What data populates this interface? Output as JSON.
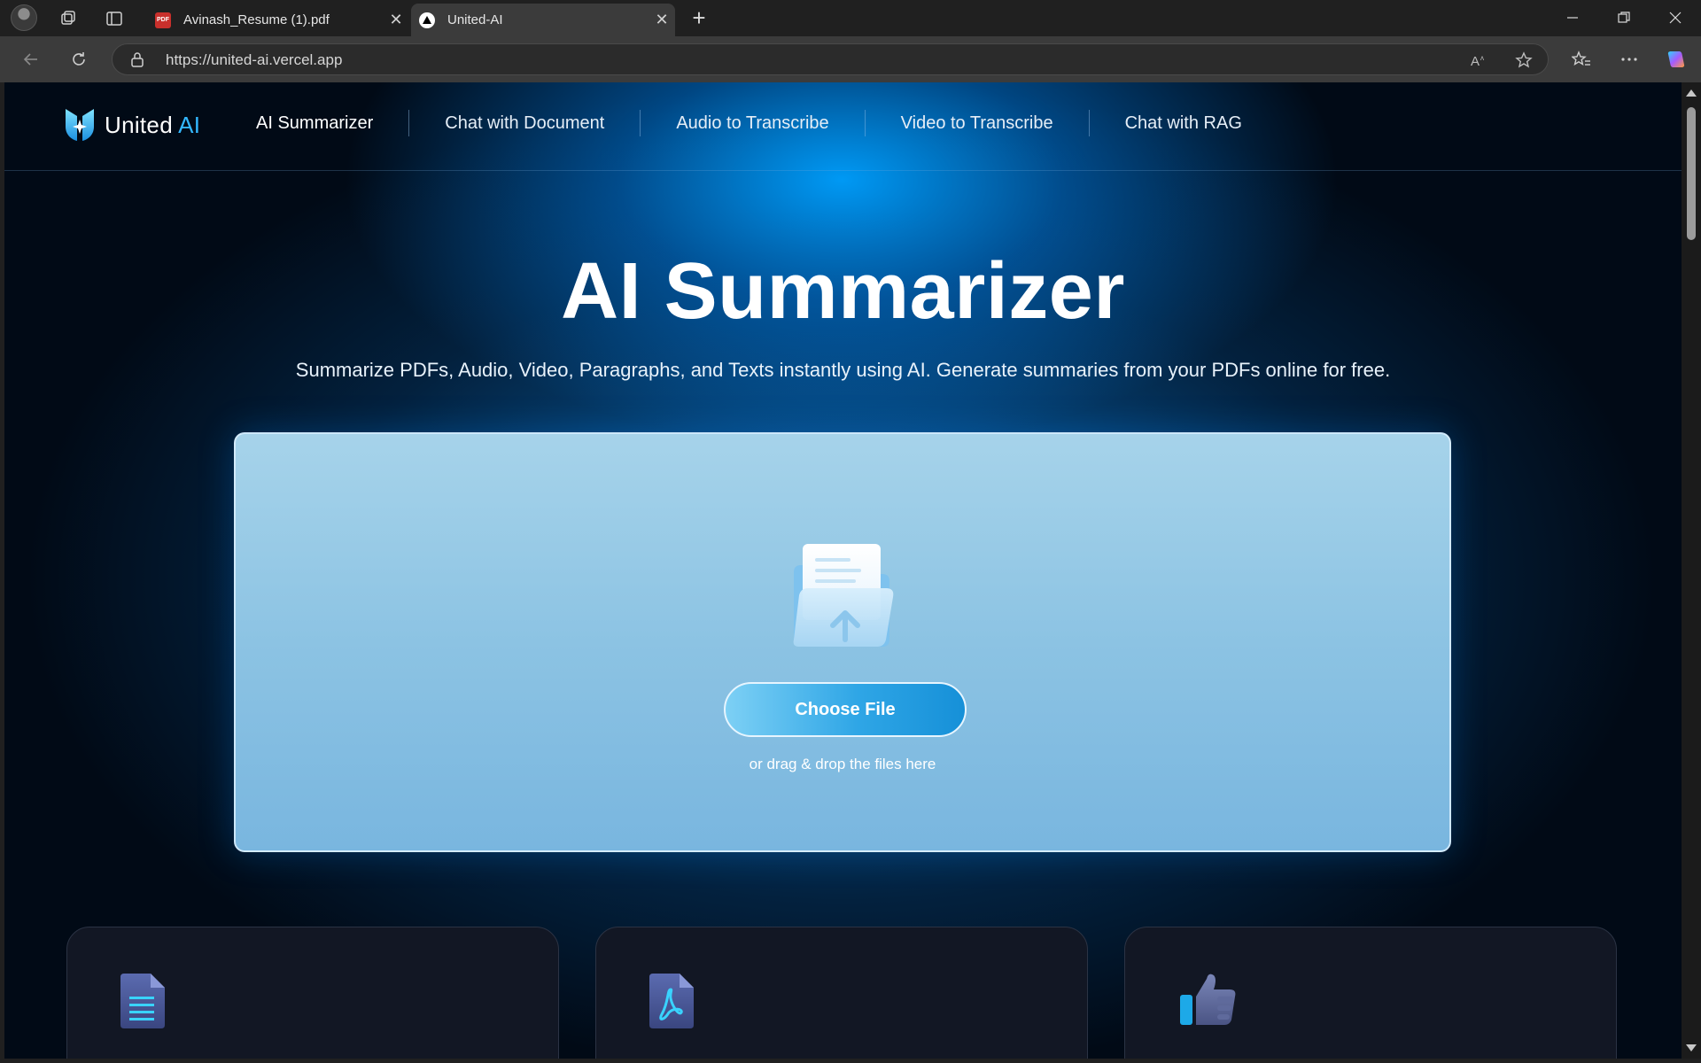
{
  "browser": {
    "tabs": [
      {
        "title": "Avinash_Resume (1).pdf",
        "favicon": "pdf-icon",
        "active": false
      },
      {
        "title": "United-AI",
        "favicon": "vercel-icon",
        "active": true
      }
    ],
    "url": "https://united-ai.vercel.app",
    "pdf_badge": "PDF"
  },
  "site": {
    "logo_text": "United",
    "logo_accent": "AI",
    "nav": [
      {
        "label": "AI Summarizer"
      },
      {
        "label": "Chat with Document"
      },
      {
        "label": "Audio to Transcribe"
      },
      {
        "label": "Video to Transcribe"
      },
      {
        "label": "Chat with RAG"
      }
    ]
  },
  "hero": {
    "title": "AI Summarizer",
    "subtitle": "Summarize PDFs, Audio, Video, Paragraphs, and Texts instantly using AI. Generate summaries from your PDFs online for free."
  },
  "upload": {
    "button_label": "Choose File",
    "hint": "or drag & drop the files here"
  },
  "cards": [
    {
      "icon": "document-icon"
    },
    {
      "icon": "pdf-file-icon"
    },
    {
      "icon": "thumbs-up-icon"
    }
  ],
  "colors": {
    "accent": "#33b8ff",
    "button": "#2fa6e6",
    "card_bg": "#121724"
  }
}
